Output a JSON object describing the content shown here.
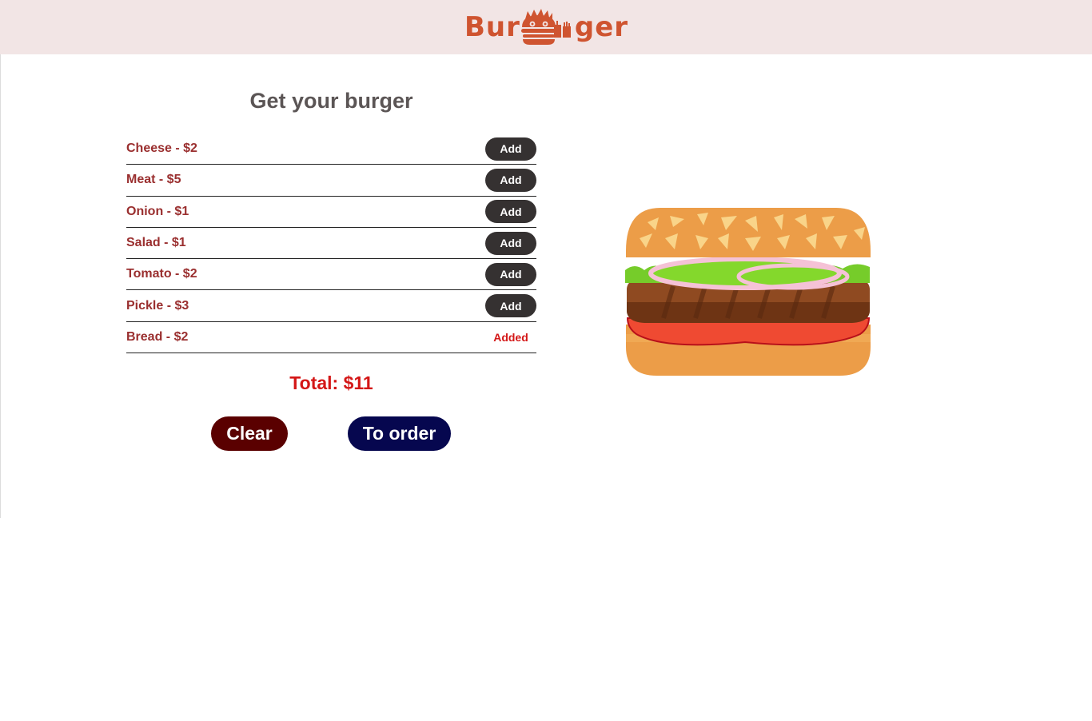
{
  "header": {
    "logo_left": "Bur",
    "logo_right": "ger"
  },
  "title": "Get your burger",
  "ingredients": [
    {
      "label": "Cheese - $2",
      "action": "Add"
    },
    {
      "label": "Meat - $5",
      "action": "Add"
    },
    {
      "label": "Onion - $1",
      "action": "Add"
    },
    {
      "label": "Salad - $1",
      "action": "Add"
    },
    {
      "label": "Tomato - $2",
      "action": "Add"
    },
    {
      "label": "Pickle - $3",
      "action": "Add"
    },
    {
      "label": "Bread - $2",
      "status": "Added"
    }
  ],
  "total": "Total: $11",
  "buttons": {
    "clear": "Clear",
    "order": "To order"
  },
  "colors": {
    "header_bg": "#f2e5e5",
    "logo": "#cf5430",
    "ingredient_text": "#9a2f2f",
    "add_button": "#353131",
    "added": "#d41818",
    "total": "#d41717",
    "clear_button": "#5a0000",
    "order_button": "#06074f"
  },
  "icons": {
    "logo_mark": "burger-face-icon",
    "drink": "drink-cup-icon",
    "fries": "fries-icon",
    "burger_preview": "burger-illustration"
  }
}
